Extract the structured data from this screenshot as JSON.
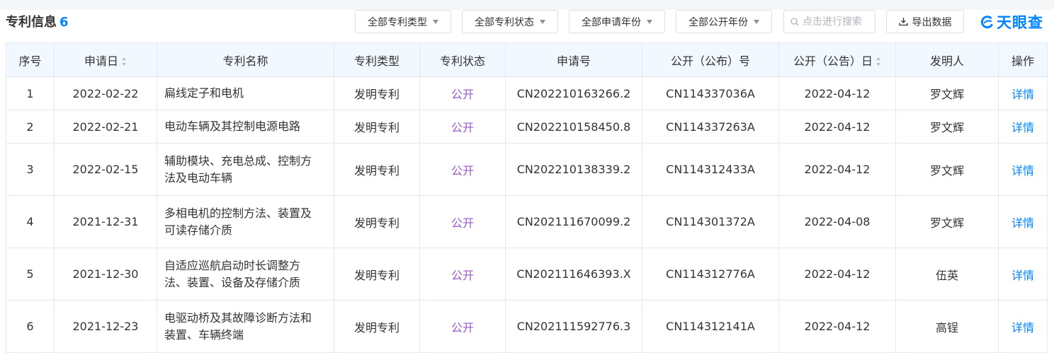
{
  "section": {
    "title": "专利信息",
    "count": "6"
  },
  "filters": [
    {
      "label": "全部专利类型"
    },
    {
      "label": "全部专利状态"
    },
    {
      "label": "全部申请年份"
    },
    {
      "label": "全部公开年份"
    }
  ],
  "search": {
    "placeholder": "点击进行搜索",
    "value": ""
  },
  "export": {
    "label": "导出数据"
  },
  "logo": {
    "text": "天眼查"
  },
  "colors": {
    "accent": "#0084ff",
    "status": "#9b59c8",
    "header_bg": "#f2f8ff",
    "border": "#e4e9f0"
  },
  "table": {
    "headers": [
      "序号",
      "申请日",
      "专利名称",
      "专利类型",
      "专利状态",
      "申请号",
      "公开（公布）号",
      "公开（公告）日",
      "发明人",
      "操作"
    ],
    "rows": [
      {
        "index": "1",
        "apply_date": "2022-02-22",
        "name_lines": [
          "扁线定子和电机"
        ],
        "type": "发明专利",
        "status": "公开",
        "apply_no": "CN202210163266.2",
        "pub_no": "CN114337036A",
        "pub_date": "2022-04-12",
        "inventor": "罗文辉",
        "action": "详情"
      },
      {
        "index": "2",
        "apply_date": "2022-02-21",
        "name_lines": [
          "电动车辆及其控制电源电路"
        ],
        "type": "发明专利",
        "status": "公开",
        "apply_no": "CN202210158450.8",
        "pub_no": "CN114337263A",
        "pub_date": "2022-04-12",
        "inventor": "罗文辉",
        "action": "详情"
      },
      {
        "index": "3",
        "apply_date": "2022-02-15",
        "name_lines": [
          "辅助模块、充电总成、控制方",
          "法及电动车辆"
        ],
        "type": "发明专利",
        "status": "公开",
        "apply_no": "CN202210138339.2",
        "pub_no": "CN114312433A",
        "pub_date": "2022-04-12",
        "inventor": "罗文辉",
        "action": "详情"
      },
      {
        "index": "4",
        "apply_date": "2021-12-31",
        "name_lines": [
          "多相电机的控制方法、装置及",
          "可读存储介质"
        ],
        "type": "发明专利",
        "status": "公开",
        "apply_no": "CN202111670099.2",
        "pub_no": "CN114301372A",
        "pub_date": "2022-04-08",
        "inventor": "罗文辉",
        "action": "详情"
      },
      {
        "index": "5",
        "apply_date": "2021-12-30",
        "name_lines": [
          "自适应巡航启动时长调整方",
          "法、装置、设备及存储介质"
        ],
        "type": "发明专利",
        "status": "公开",
        "apply_no": "CN202111646393.X",
        "pub_no": "CN114312776A",
        "pub_date": "2022-04-12",
        "inventor": "伍英",
        "action": "详情"
      },
      {
        "index": "6",
        "apply_date": "2021-12-23",
        "name_lines": [
          "电驱动桥及其故障诊断方法和",
          "装置、车辆终端"
        ],
        "type": "发明专利",
        "status": "公开",
        "apply_no": "CN202111592776.3",
        "pub_no": "CN114312141A",
        "pub_date": "2022-04-12",
        "inventor": "高锃",
        "action": "详情"
      }
    ]
  }
}
